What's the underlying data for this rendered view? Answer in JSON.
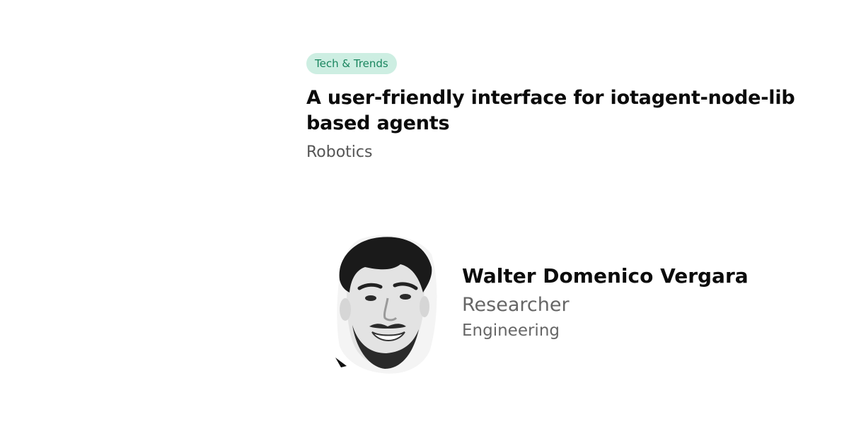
{
  "post": {
    "tag": "Tech & Trends",
    "title": "A user-friendly interface for iotagent-node-lib based agents",
    "category": "Robotics"
  },
  "author": {
    "name": "Walter Domenico Vergara",
    "role": "Researcher",
    "department": "Engineering"
  },
  "colors": {
    "tag_background": "#cdeee2",
    "tag_text": "#19855e",
    "title_text": "#0b0b0b",
    "muted_text": "#666666"
  }
}
